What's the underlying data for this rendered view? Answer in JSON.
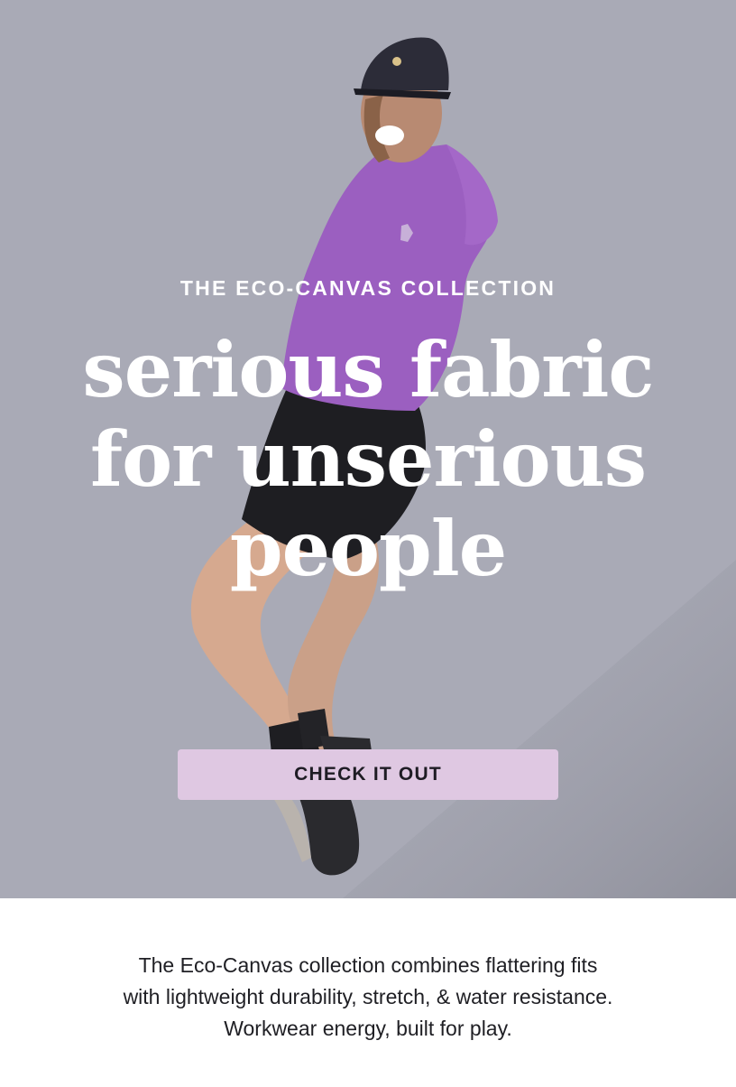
{
  "hero": {
    "eyebrow": "THE ECO-CANVAS COLLECTION",
    "headline_lines": [
      "serious fabric",
      "for unserious",
      "people"
    ],
    "cta_label": "CHECK IT OUT",
    "background_color": "#a9aab6",
    "cta_color": "#dfc8e2",
    "jacket_color": "#9b5fc0",
    "photo_description": "hero-photo-model-in-purple-hooded-jacket-and-black-shorts"
  },
  "body": {
    "lines": [
      "The Eco-Canvas collection combines flattering fits",
      "with lightweight durability, stretch, & water resistance.",
      "Workwear energy, built for play."
    ]
  }
}
